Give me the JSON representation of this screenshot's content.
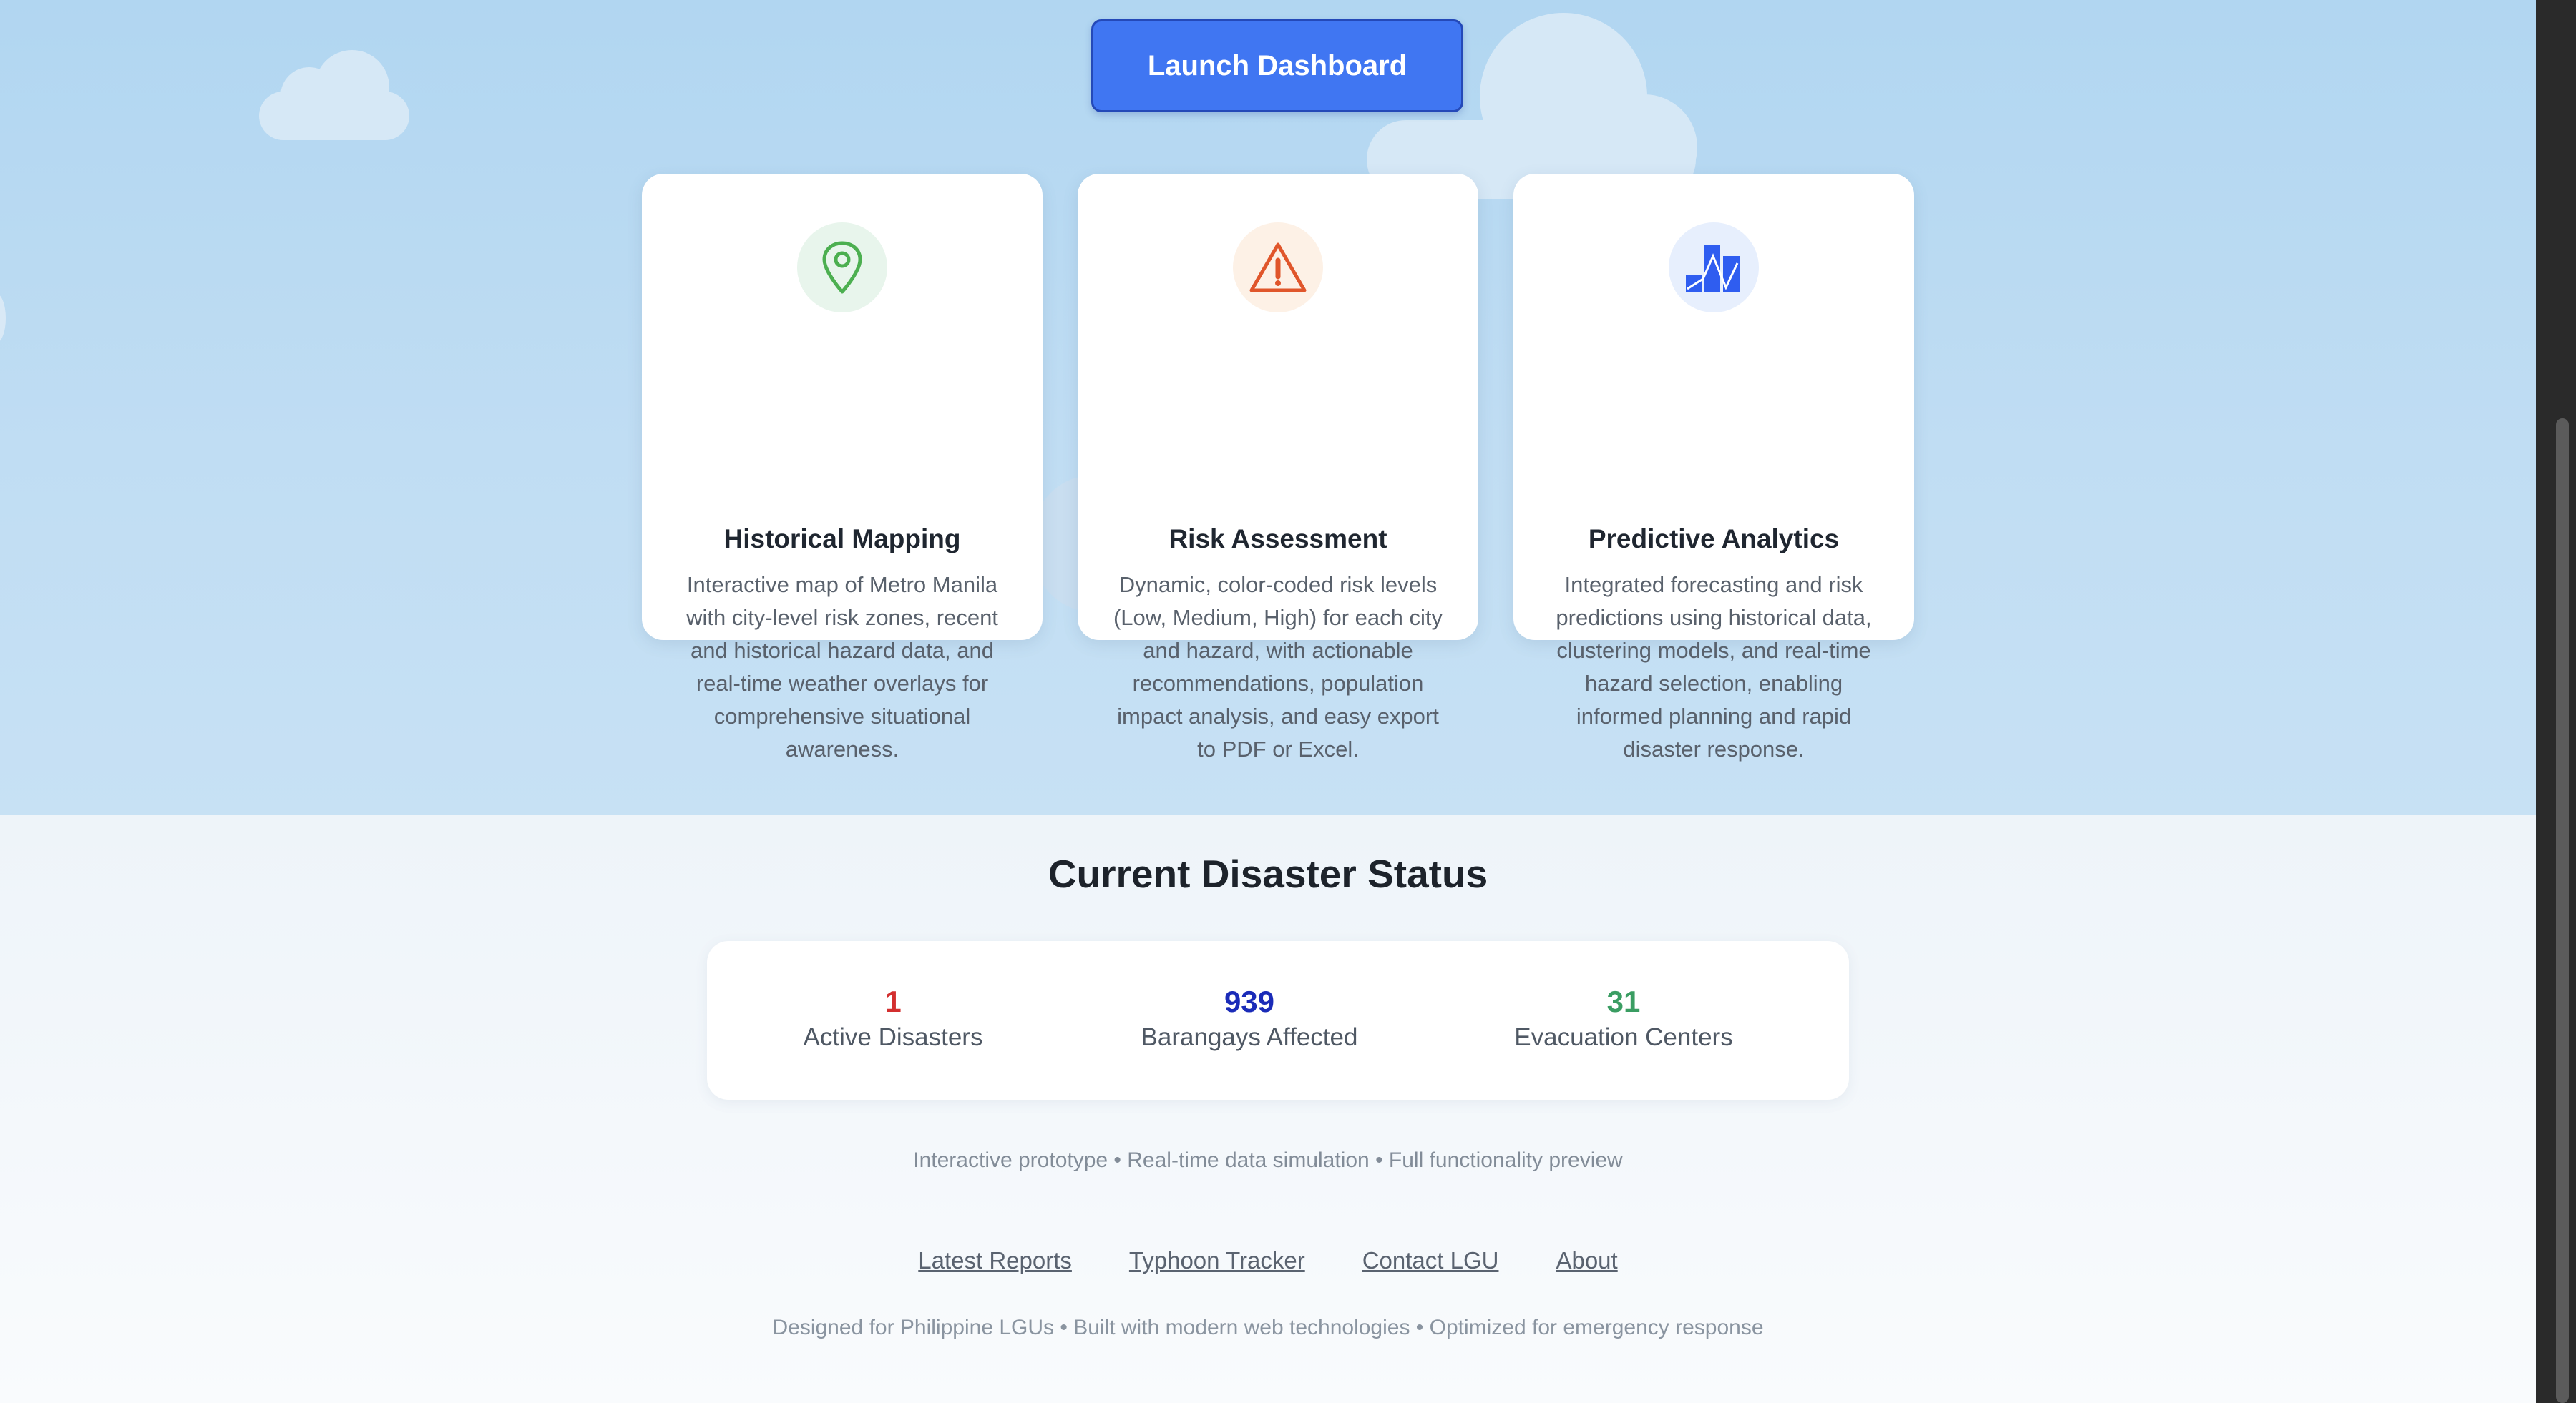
{
  "hero": {
    "launch_button": "Launch Dashboard"
  },
  "features": [
    {
      "icon": "map-pin-icon",
      "title": "Historical Mapping",
      "description": "Interactive map of Metro Manila with city-level risk zones, recent and historical hazard data, and real-time weather overlays for comprehensive situational awareness."
    },
    {
      "icon": "warning-triangle-icon",
      "title": "Risk Assessment",
      "description": "Dynamic, color-coded risk levels (Low, Medium, High) for each city and hazard, with actionable recommendations, population impact analysis, and easy export to PDF or Excel."
    },
    {
      "icon": "bar-chart-icon",
      "title": "Predictive Analytics",
      "description": "Integrated forecasting and risk predictions using historical data, clustering models, and real-time hazard selection, enabling informed planning and rapid disaster response."
    }
  ],
  "status": {
    "heading": "Current Disaster Status",
    "stats": [
      {
        "value": "1",
        "label": "Active Disasters",
        "color": "#d32f2f"
      },
      {
        "value": "939",
        "label": "Barangays Affected",
        "color": "#1a2bb8"
      },
      {
        "value": "31",
        "label": "Evacuation Centers",
        "color": "#3a9d62"
      }
    ]
  },
  "tagline": "Interactive prototype • Real-time data simulation • Full functionality preview",
  "footer": {
    "links": [
      "Latest Reports",
      "Typhoon Tracker",
      "Contact LGU",
      "About"
    ],
    "note": "Designed for Philippine LGUs • Built with modern web technologies • Optimized for emergency response"
  },
  "colors": {
    "primary_button": "#4076f2",
    "map_icon": "#4caf50",
    "warning_icon": "#e0562b",
    "chart_icon": "#2f5df0"
  }
}
